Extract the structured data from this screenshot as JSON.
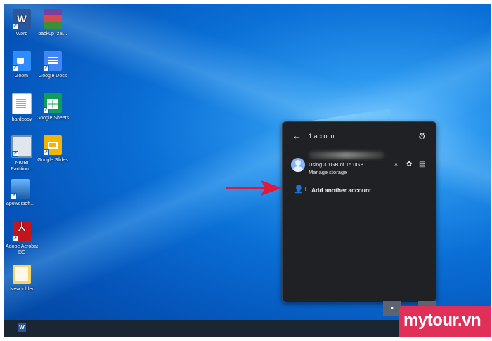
{
  "desktop": {
    "icons": [
      {
        "label": "Word",
        "icon": "word-icon"
      },
      {
        "label": "backup_zal...",
        "icon": "winrar-archive-icon"
      },
      {
        "label": "Zoom",
        "icon": "zoom-icon"
      },
      {
        "label": "Google Docs",
        "icon": "google-docs-icon"
      },
      {
        "label": "hardcopy",
        "icon": "document-icon"
      },
      {
        "label": "Google Sheets",
        "icon": "google-sheets-icon"
      },
      {
        "label": "NIUBI Partition...",
        "icon": "niubi-partition-icon"
      },
      {
        "label": "Google Slides",
        "icon": "google-slides-icon"
      },
      {
        "label": "apowersoft...",
        "icon": "apowersoft-icon"
      },
      {
        "label": "Adobe Acrobat DC",
        "icon": "adobe-acrobat-icon"
      },
      {
        "label": "New folder",
        "icon": "folder-icon"
      }
    ]
  },
  "drive_panel": {
    "title": "1 account",
    "back_icon": "←",
    "settings_icon": "⚙",
    "storage_text": "Using 3.1GB of 15.0GB",
    "manage_storage_label": "Manage storage",
    "quick_icons": [
      "▵",
      "✿",
      "▤"
    ],
    "add_account_icon": "👤+",
    "add_account_label": "Add another account"
  },
  "taskbar": {
    "word_letter": "W"
  },
  "watermark": {
    "text": "mytour.vn"
  },
  "colors": {
    "panel_bg": "#202124",
    "arrow": "#e3173e",
    "watermark_bg": "#e0305a",
    "desktop_blue": "#0a6fd6"
  }
}
